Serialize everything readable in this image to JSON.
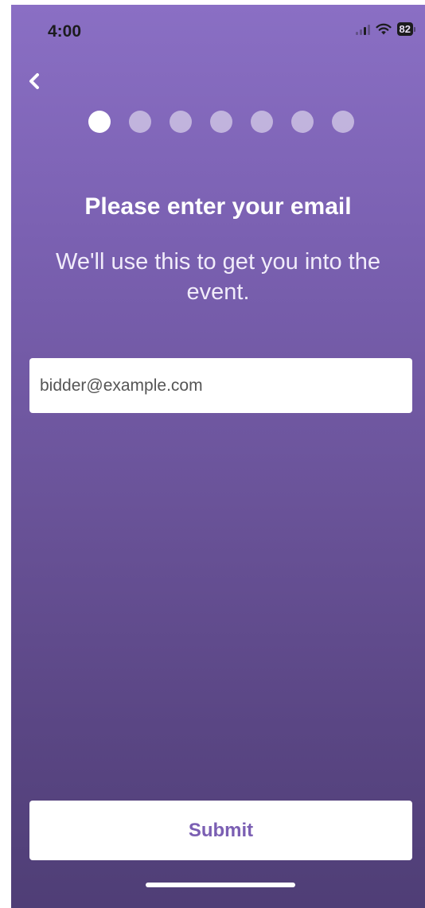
{
  "status_bar": {
    "time": "4:00",
    "battery": "82",
    "signal_icon": "signal-icon",
    "wifi_icon": "wifi-icon",
    "battery_icon": "battery-icon"
  },
  "navigation": {
    "back_icon": "chevron-left-icon"
  },
  "progress": {
    "total_steps": 7,
    "current_step": 1
  },
  "content": {
    "title": "Please enter your email",
    "subtitle": "We'll use this to get you into the event."
  },
  "email_field": {
    "value": "",
    "placeholder": "bidder@example.com"
  },
  "actions": {
    "submit_label": "Submit"
  },
  "colors": {
    "background_top": "#8a6fc4",
    "background_bottom": "#4f3e76",
    "accent": "#7b5fb3"
  }
}
